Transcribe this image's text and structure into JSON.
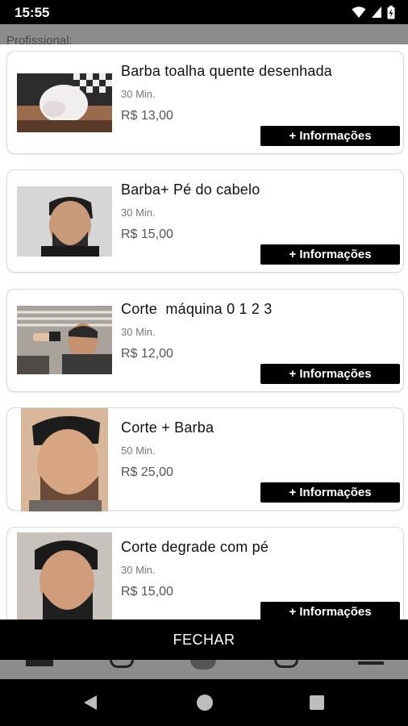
{
  "status_bar": {
    "time": "15:55"
  },
  "background": {
    "label": "Profissional:"
  },
  "services": [
    {
      "name": "Barba toalha quente desenhada",
      "duration": "30 Min.",
      "price": "R$ 13,00",
      "button": "+ Informações"
    },
    {
      "name": "Barba+ Pé do cabelo",
      "duration": "30 Min.",
      "price": "R$ 15,00",
      "button": "+ Informações"
    },
    {
      "name": "Corte  máquina 0 1 2 3",
      "duration": "30 Min.",
      "price": "R$ 12,00",
      "button": "+ Informações"
    },
    {
      "name": "Corte + Barba",
      "duration": "50 Min.",
      "price": "R$ 25,00",
      "button": "+ Informações"
    },
    {
      "name": "Corte degrade com pé",
      "duration": "30 Min.",
      "price": "R$ 15,00",
      "button": "+ Informações"
    }
  ],
  "dialog": {
    "close_label": "FECHAR"
  },
  "icons": [
    "wifi-icon",
    "signal-icon",
    "battery-icon",
    "back-icon",
    "home-icon",
    "recents-icon"
  ]
}
